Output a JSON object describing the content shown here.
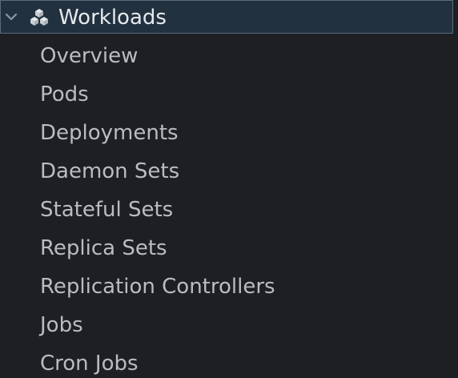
{
  "group": {
    "title": "Workloads",
    "expanded": true,
    "icon": "cubes-icon",
    "chevron_icon": "chevron-down-icon"
  },
  "items": [
    {
      "label": "Overview"
    },
    {
      "label": "Pods"
    },
    {
      "label": "Deployments"
    },
    {
      "label": "Daemon Sets"
    },
    {
      "label": "Stateful Sets"
    },
    {
      "label": "Replica Sets"
    },
    {
      "label": "Replication Controllers"
    },
    {
      "label": "Jobs"
    },
    {
      "label": "Cron Jobs"
    }
  ],
  "colors": {
    "background": "#1e1f22",
    "header_background": "#22313f",
    "header_border": "#5a6b7c",
    "header_text": "#e6e9ec",
    "item_text": "#b8bdc3"
  }
}
